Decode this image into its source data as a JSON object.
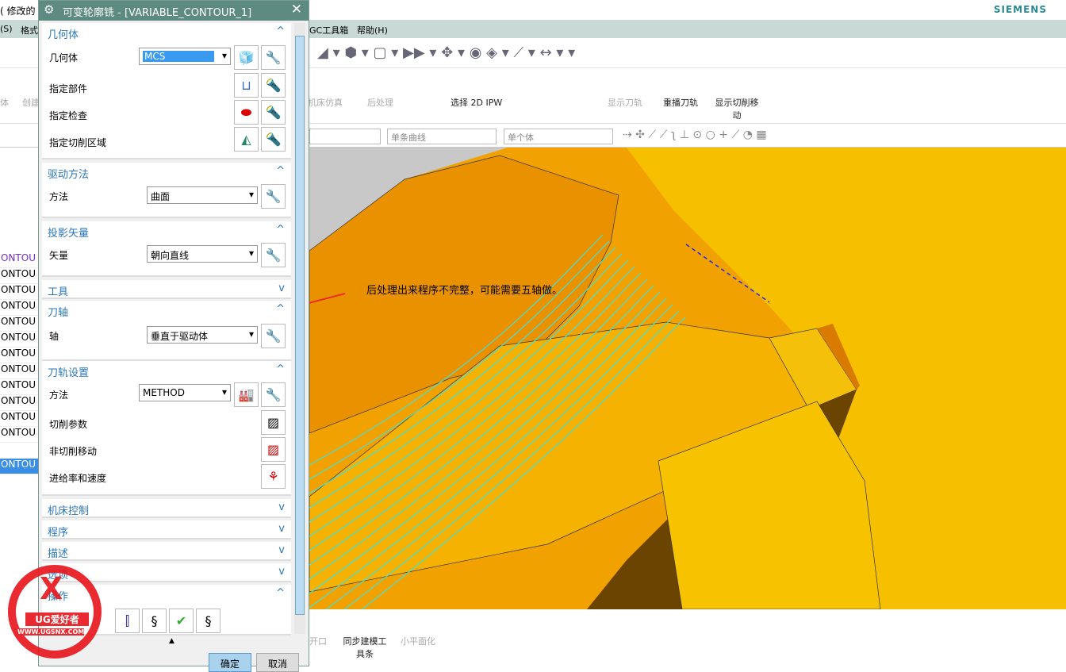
{
  "window": {
    "partial_title": "( 修改的",
    "brand": "SIEMENS"
  },
  "menu": {
    "left": [
      "(S)",
      "格式"
    ],
    "right": [
      "GC工具箱",
      "帮助(H)"
    ]
  },
  "ribbon": {
    "items": [
      {
        "label": "体",
        "enabled": false
      },
      {
        "label": "创建",
        "enabled": false
      },
      {
        "label": "机床仿真",
        "enabled": false
      },
      {
        "label": "后处理",
        "enabled": false
      },
      {
        "label": "选择 2D IPW",
        "enabled": true
      },
      {
        "label": "显示刀轨",
        "enabled": false
      },
      {
        "label": "重播刀轨",
        "enabled": true
      },
      {
        "label": "显示切削移动",
        "enabled": true,
        "active": true
      }
    ]
  },
  "selection_bar": {
    "filter1": "单条曲线",
    "filter2": "单个体"
  },
  "tree": {
    "rows": [
      "ONTOU",
      "ONTOU",
      "ONTOU",
      "ONTOU",
      "ONTOU",
      "ONTOU",
      "ONTOU",
      "ONTOU",
      "ONTOU",
      "ONTOU",
      "ONTOU",
      "ONTOU",
      "ONTOU"
    ]
  },
  "dialog": {
    "title": "可变轮廓铣 - [VARIABLE_CONTOUR_1]",
    "geometry": {
      "header": "几何体",
      "geom_label": "几何体",
      "geom_value": "MCS",
      "part": "指定部件",
      "check": "指定检查",
      "cut_area": "指定切削区域"
    },
    "drive": {
      "header": "驱动方法",
      "method_label": "方法",
      "method_value": "曲面"
    },
    "projection": {
      "header": "投影矢量",
      "vector_label": "矢量",
      "vector_value": "朝向直线"
    },
    "tool": {
      "header": "工具"
    },
    "tool_axis": {
      "header": "刀轴",
      "axis_label": "轴",
      "axis_value": "垂直于驱动体"
    },
    "path_settings": {
      "header": "刀轨设置",
      "method_label": "方法",
      "method_value": "METHOD",
      "cut_params": "切削参数",
      "non_cut": "非切削移动",
      "feeds": "进给率和速度"
    },
    "machine_control": {
      "header": "机床控制"
    },
    "program": {
      "header": "程序"
    },
    "description": {
      "header": "描述"
    },
    "options": {
      "header": "选项"
    },
    "actions": {
      "header": "操作"
    },
    "ok": "确定",
    "cancel": "取消"
  },
  "annotation": {
    "text": "后处理出来程序不完整，可能需要五轴做。",
    "color": "#e8302a"
  },
  "bottom_ribbon": {
    "items": [
      "开口",
      "同步建模工具条",
      "小平面化"
    ]
  },
  "watermark": {
    "text": "UG爱好者",
    "url": "WWW.UGSNX.COM"
  },
  "colors": {
    "title_bar": "#5d8a81",
    "header_text": "#2b77b8",
    "part": "#f5a800",
    "toolpath": "#40e0e0"
  }
}
